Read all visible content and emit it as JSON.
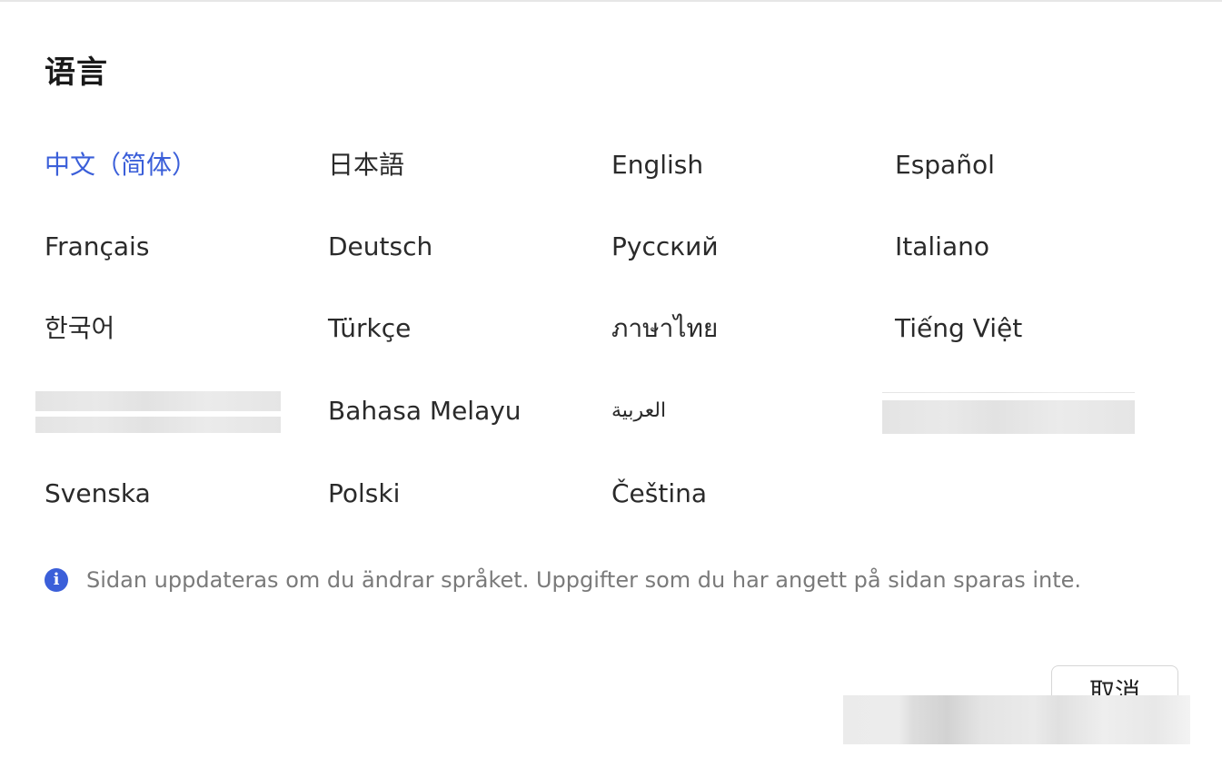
{
  "dialog": {
    "title": "语言",
    "languages": [
      {
        "label": "中文（简体）",
        "selected": true
      },
      {
        "label": "日本語"
      },
      {
        "label": "English"
      },
      {
        "label": "Español"
      },
      {
        "label": "Français"
      },
      {
        "label": "Deutsch"
      },
      {
        "label": "Русский"
      },
      {
        "label": "Italiano"
      },
      {
        "label": "한국어"
      },
      {
        "label": "Türkçe"
      },
      {
        "label": "ภาษาไทย"
      },
      {
        "label": "Tiếng Việt"
      },
      {
        "label": "Bahasa Melayu"
      },
      {
        "label": "العربية"
      },
      {
        "label": "Svenska"
      },
      {
        "label": "Polski"
      },
      {
        "label": "Čeština"
      }
    ],
    "notice": {
      "icon": "info-icon",
      "text": "Sidan uppdateras om du ändrar språket. Uppgifter som du har angett på sidan sparas inte."
    },
    "cancel_label": "取消"
  },
  "colors": {
    "accent": "#3b5fd9",
    "text": "#2a2a2a",
    "muted": "#7a7a7a"
  }
}
